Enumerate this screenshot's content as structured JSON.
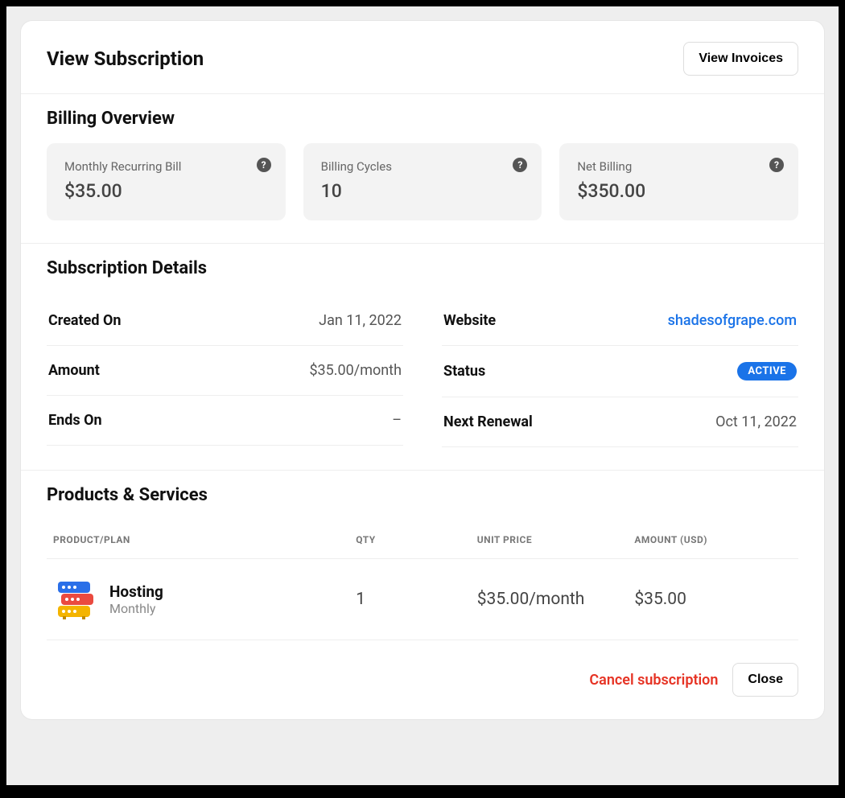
{
  "header": {
    "title": "View Subscription",
    "view_invoices_label": "View Invoices"
  },
  "billing_overview": {
    "heading": "Billing Overview",
    "cards": [
      {
        "label": "Monthly Recurring Bill",
        "value": "$35.00"
      },
      {
        "label": "Billing Cycles",
        "value": "10"
      },
      {
        "label": "Net Billing",
        "value": "$350.00"
      }
    ]
  },
  "subscription_details": {
    "heading": "Subscription Details",
    "rows_left": [
      {
        "label": "Created On",
        "value": "Jan 11, 2022"
      },
      {
        "label": "Amount",
        "value": "$35.00/month"
      },
      {
        "label": "Ends On",
        "value": "–"
      }
    ],
    "rows_right": [
      {
        "label": "Website",
        "value": "shadesofgrape.com",
        "is_link": true
      },
      {
        "label": "Status",
        "value": "ACTIVE",
        "is_badge": true
      },
      {
        "label": "Next Renewal",
        "value": "Oct 11, 2022"
      }
    ]
  },
  "products": {
    "heading": "Products & Services",
    "columns": {
      "product": "PRODUCT/PLAN",
      "qty": "QTY",
      "unit_price": "UNIT PRICE",
      "amount": "AMOUNT (USD)"
    },
    "rows": [
      {
        "name": "Hosting",
        "plan": "Monthly",
        "qty": "1",
        "unit_price": "$35.00/month",
        "amount": "$35.00"
      }
    ]
  },
  "footer": {
    "cancel_label": "Cancel subscription",
    "close_label": "Close"
  },
  "icons": {
    "help": "?"
  }
}
